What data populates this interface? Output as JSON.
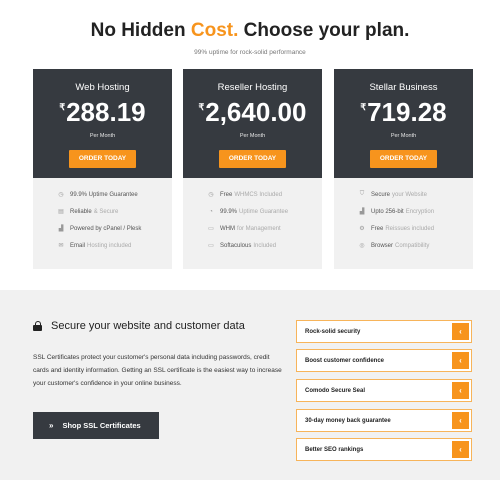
{
  "hero": {
    "title_prefix": "No Hidden ",
    "title_accent": "Cost.",
    "title_suffix": " Choose your plan.",
    "subtitle": "99% uptime for rock-solid performance"
  },
  "colors": {
    "accent": "#f7941d",
    "dark": "#363a40",
    "panel": "#f1f1f1"
  },
  "plans": [
    {
      "name": "Web Hosting",
      "currency": "₹",
      "price": "288.19",
      "period": "Per Month",
      "button": "ORDER TODAY",
      "features": [
        {
          "icon": "clock-icon",
          "text": "99.9% Uptime Guarantee",
          "faint": ""
        },
        {
          "icon": "server-icon",
          "text": "Reliable",
          "faint": "& Secure"
        },
        {
          "icon": "signal-icon",
          "text": "Powered by cPanel / Plesk",
          "faint": ""
        },
        {
          "icon": "mail-icon",
          "text": "Email",
          "faint": "Hosting included"
        }
      ]
    },
    {
      "name": "Reseller Hosting",
      "currency": "₹",
      "price": "2,640.00",
      "period": "Per Month",
      "button": "ORDER TODAY",
      "features": [
        {
          "icon": "clock-icon",
          "text": "Free",
          "faint": "WHMCS Included"
        },
        {
          "icon": "gauge-icon",
          "text": "99.9%",
          "faint": "Uptime Guarantee"
        },
        {
          "icon": "hdd-icon",
          "text": "WHM",
          "faint": "for Management"
        },
        {
          "icon": "laptop-icon",
          "text": "Softaculous",
          "faint": "Included"
        }
      ]
    },
    {
      "name": "Stellar Business",
      "currency": "₹",
      "price": "719.28",
      "period": "Per Month",
      "button": "ORDER TODAY",
      "features": [
        {
          "icon": "shield-icon",
          "text": "Secure",
          "faint": "your Website"
        },
        {
          "icon": "signal-icon",
          "text": "Upto 256-bit",
          "faint": "Encryption"
        },
        {
          "icon": "gear-icon",
          "text": "Free",
          "faint": "Reissues included"
        },
        {
          "icon": "globe-icon",
          "text": "Browser",
          "faint": "Compatibility"
        }
      ]
    }
  ],
  "ssl": {
    "heading": "Secure your website and customer data",
    "description": "SSL Certificates protect your customer's personal data including passwords, credit cards and identity information. Getting an SSL certificate is the easiest way to increase your customer's confidence in your online business.",
    "button": "Shop SSL Certificates",
    "accordion": [
      "Rock-solid security",
      "Boost customer confidence",
      "Comodo Secure Seal",
      "30-day money back guarantee",
      "Better SEO rankings"
    ]
  }
}
